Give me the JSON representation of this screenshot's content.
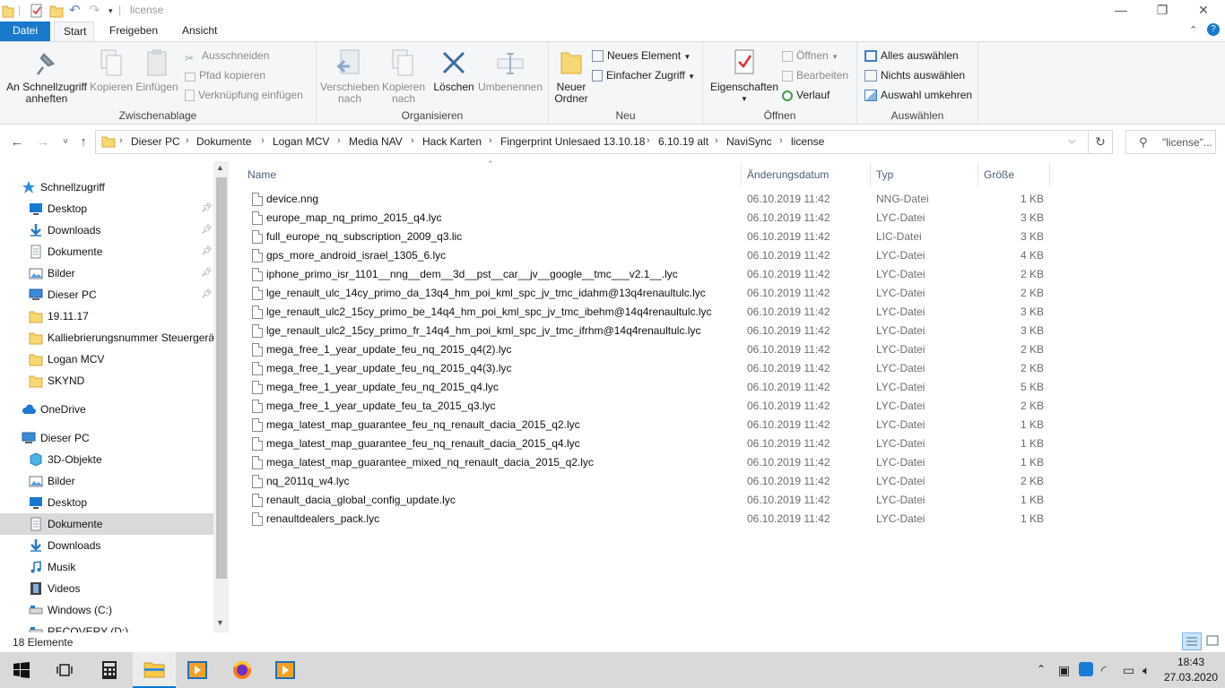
{
  "window": {
    "title": "license",
    "minimize_glyph": "—",
    "maximize_glyph": "❐",
    "close_glyph": "✕"
  },
  "ribbon_tabs": [
    "Datei",
    "Start",
    "Freigeben",
    "Ansicht"
  ],
  "ribbon": {
    "clipboard": {
      "label": "Zwischenablage",
      "pin": "An Schnellzugriff\nanheften",
      "copy": "Kopieren",
      "paste": "Einfügen",
      "cut": "Ausschneiden",
      "copy_path": "Pfad kopieren",
      "paste_shortcut": "Verknüpfung einfügen"
    },
    "organize": {
      "label": "Organisieren",
      "move_to": "Verschieben\nnach",
      "copy_to": "Kopieren\nnach",
      "delete": "Löschen",
      "rename": "Umbenennen"
    },
    "new": {
      "label": "Neu",
      "new_folder": "Neuer\nOrdner",
      "new_item": "Neues Element",
      "easy_access": "Einfacher Zugriff"
    },
    "open": {
      "label": "Öffnen",
      "properties": "Eigenschaften",
      "open": "Öffnen",
      "edit": "Bearbeiten",
      "history": "Verlauf"
    },
    "select": {
      "label": "Auswählen",
      "select_all": "Alles auswählen",
      "select_none": "Nichts auswählen",
      "invert": "Auswahl umkehren"
    }
  },
  "address": {
    "breadcrumbs": [
      "Dieser PC",
      "Dokumente",
      "Logan MCV",
      "Media NAV",
      "Hack Karten",
      "Fingerprint Unlesaed 13.10.18",
      "6.10.19 alt",
      "NaviSync",
      "license"
    ],
    "search_placeholder": "\"license\"..."
  },
  "nav_pane": [
    {
      "label": "Schnellzugriff",
      "icon": "star-icon",
      "indent": 0,
      "pinned": false
    },
    {
      "label": "Desktop",
      "icon": "desktop-icon",
      "indent": 1,
      "pinned": true
    },
    {
      "label": "Downloads",
      "icon": "download-icon",
      "indent": 1,
      "pinned": true
    },
    {
      "label": "Dokumente",
      "icon": "documents-icon",
      "indent": 1,
      "pinned": true
    },
    {
      "label": "Bilder",
      "icon": "pictures-icon",
      "indent": 1,
      "pinned": true
    },
    {
      "label": "Dieser PC",
      "icon": "pc-icon",
      "indent": 1,
      "pinned": true
    },
    {
      "label": "19.11.17",
      "icon": "folder-icon",
      "indent": 1,
      "pinned": false
    },
    {
      "label": "Kalliebrierungsnummer Steuergerät",
      "icon": "folder-icon",
      "indent": 1,
      "pinned": false
    },
    {
      "label": "Logan MCV",
      "icon": "folder-icon",
      "indent": 1,
      "pinned": false
    },
    {
      "label": "SKYND",
      "icon": "folder-icon",
      "indent": 1,
      "pinned": false
    },
    {
      "label": "OneDrive",
      "icon": "cloud-icon",
      "indent": 0,
      "pinned": false
    },
    {
      "label": "Dieser PC",
      "icon": "pc-icon",
      "indent": 0,
      "pinned": false
    },
    {
      "label": "3D-Objekte",
      "icon": "3d-objects-icon",
      "indent": 1,
      "pinned": false
    },
    {
      "label": "Bilder",
      "icon": "pictures-icon",
      "indent": 1,
      "pinned": false
    },
    {
      "label": "Desktop",
      "icon": "desktop-icon",
      "indent": 1,
      "pinned": false
    },
    {
      "label": "Dokumente",
      "icon": "documents-icon",
      "indent": 1,
      "pinned": false,
      "selected": true
    },
    {
      "label": "Downloads",
      "icon": "download-icon",
      "indent": 1,
      "pinned": false
    },
    {
      "label": "Musik",
      "icon": "music-icon",
      "indent": 1,
      "pinned": false
    },
    {
      "label": "Videos",
      "icon": "videos-icon",
      "indent": 1,
      "pinned": false
    },
    {
      "label": "Windows (C:)",
      "icon": "drive-icon",
      "indent": 1,
      "pinned": false
    },
    {
      "label": "RECOVERY (D:)",
      "icon": "drive-icon",
      "indent": 1,
      "pinned": false
    }
  ],
  "columns": {
    "name": "Name",
    "date": "Änderungsdatum",
    "type": "Typ",
    "size": "Größe"
  },
  "files": [
    {
      "name": "device.nng",
      "date": "06.10.2019 11:42",
      "type": "NNG-Datei",
      "size": "1 KB"
    },
    {
      "name": "europe_map_nq_primo_2015_q4.lyc",
      "date": "06.10.2019 11:42",
      "type": "LYC-Datei",
      "size": "3 KB"
    },
    {
      "name": "full_europe_nq_subscription_2009_q3.lic",
      "date": "06.10.2019 11:42",
      "type": "LIC-Datei",
      "size": "3 KB"
    },
    {
      "name": "gps_more_android_israel_1305_6.lyc",
      "date": "06.10.2019 11:42",
      "type": "LYC-Datei",
      "size": "4 KB"
    },
    {
      "name": "iphone_primo_isr_1101__nng__dem__3d__pst__car__jv__google__tmc___v2.1__.lyc",
      "date": "06.10.2019 11:42",
      "type": "LYC-Datei",
      "size": "2 KB"
    },
    {
      "name": "lge_renault_ulc_14cy_primo_da_13q4_hm_poi_kml_spc_jv_tmc_idahm@13q4renaultulc.lyc",
      "date": "06.10.2019 11:42",
      "type": "LYC-Datei",
      "size": "2 KB"
    },
    {
      "name": "lge_renault_ulc2_15cy_primo_be_14q4_hm_poi_kml_spc_jv_tmc_ibehm@14q4renaultulc.lyc",
      "date": "06.10.2019 11:42",
      "type": "LYC-Datei",
      "size": "3 KB"
    },
    {
      "name": "lge_renault_ulc2_15cy_primo_fr_14q4_hm_poi_kml_spc_jv_tmc_ifrhm@14q4renaultulc.lyc",
      "date": "06.10.2019 11:42",
      "type": "LYC-Datei",
      "size": "3 KB"
    },
    {
      "name": "mega_free_1_year_update_feu_nq_2015_q4(2).lyc",
      "date": "06.10.2019 11:42",
      "type": "LYC-Datei",
      "size": "2 KB"
    },
    {
      "name": "mega_free_1_year_update_feu_nq_2015_q4(3).lyc",
      "date": "06.10.2019 11:42",
      "type": "LYC-Datei",
      "size": "2 KB"
    },
    {
      "name": "mega_free_1_year_update_feu_nq_2015_q4.lyc",
      "date": "06.10.2019 11:42",
      "type": "LYC-Datei",
      "size": "5 KB"
    },
    {
      "name": "mega_free_1_year_update_feu_ta_2015_q3.lyc",
      "date": "06.10.2019 11:42",
      "type": "LYC-Datei",
      "size": "2 KB"
    },
    {
      "name": "mega_latest_map_guarantee_feu_nq_renault_dacia_2015_q2.lyc",
      "date": "06.10.2019 11:42",
      "type": "LYC-Datei",
      "size": "1 KB"
    },
    {
      "name": "mega_latest_map_guarantee_feu_nq_renault_dacia_2015_q4.lyc",
      "date": "06.10.2019 11:42",
      "type": "LYC-Datei",
      "size": "1 KB"
    },
    {
      "name": "mega_latest_map_guarantee_mixed_nq_renault_dacia_2015_q2.lyc",
      "date": "06.10.2019 11:42",
      "type": "LYC-Datei",
      "size": "1 KB"
    },
    {
      "name": "nq_2011q_w4.lyc",
      "date": "06.10.2019 11:42",
      "type": "LYC-Datei",
      "size": "2 KB"
    },
    {
      "name": "renault_dacia_global_config_update.lyc",
      "date": "06.10.2019 11:42",
      "type": "LYC-Datei",
      "size": "1 KB"
    },
    {
      "name": "renaultdealers_pack.lyc",
      "date": "06.10.2019 11:42",
      "type": "LYC-Datei",
      "size": "1 KB"
    }
  ],
  "status": {
    "count": "18 Elemente"
  },
  "taskbar": {
    "apps": [
      "start-icon",
      "task-view-icon",
      "calculator-icon",
      "file-explorer-icon",
      "media-player-icon",
      "firefox-icon",
      "media-player-icon"
    ],
    "time": "18:43",
    "date": "27.03.2020"
  },
  "colors": {
    "accent": "#1979ca",
    "taskbar": "#d9d9d9",
    "ribbon_bg": "#f5f6f7",
    "selected": "#d9d9d9"
  }
}
